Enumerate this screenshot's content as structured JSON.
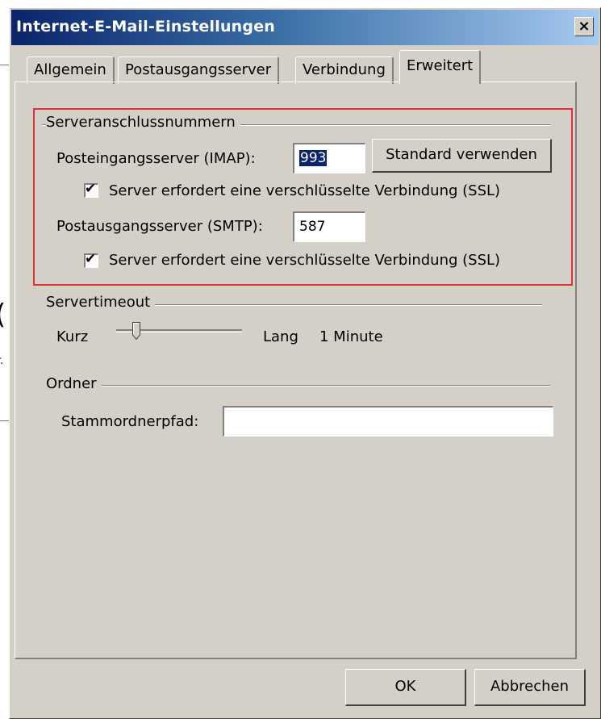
{
  "window": {
    "title": "Internet-E-Mail-Einstellungen",
    "close_glyph": "×"
  },
  "background": {
    "fragment_char_1": "(",
    "fragment_char_2": "r."
  },
  "tabs": [
    {
      "label": "Allgemein",
      "active": false
    },
    {
      "label": "Postausgangsserver",
      "active": false
    },
    {
      "label": "Verbindung",
      "active": false
    },
    {
      "label": "Erweitert",
      "active": true
    }
  ],
  "server_ports": {
    "group_label": "Serveranschlussnummern",
    "imap_label": "Posteingangsserver (IMAP):",
    "imap_value": "993",
    "default_button": "Standard verwenden",
    "imap_ssl_label": "Server erfordert eine verschlüsselte Verbindung (SSL)",
    "imap_ssl_checked": true,
    "smtp_label": "Postausgangsserver (SMTP):",
    "smtp_value": "587",
    "smtp_ssl_label": "Server erfordert eine verschlüsselte Verbindung (SSL)",
    "smtp_ssl_checked": true,
    "check_glyph": "✔"
  },
  "timeout": {
    "group_label": "Servertimeout",
    "short_label": "Kurz",
    "long_label": "Lang",
    "value_label": "1 Minute",
    "slider_level": 0.12
  },
  "folders": {
    "group_label": "Ordner",
    "root_path_label": "Stammordnerpfad:",
    "root_path_value": ""
  },
  "footer": {
    "ok_button": "OK",
    "cancel_button": "Abbrechen"
  },
  "colors": {
    "highlight_border": "#e0303a",
    "titlebar_start": "#0a246a",
    "dialog_bg": "#d4d0c8"
  }
}
